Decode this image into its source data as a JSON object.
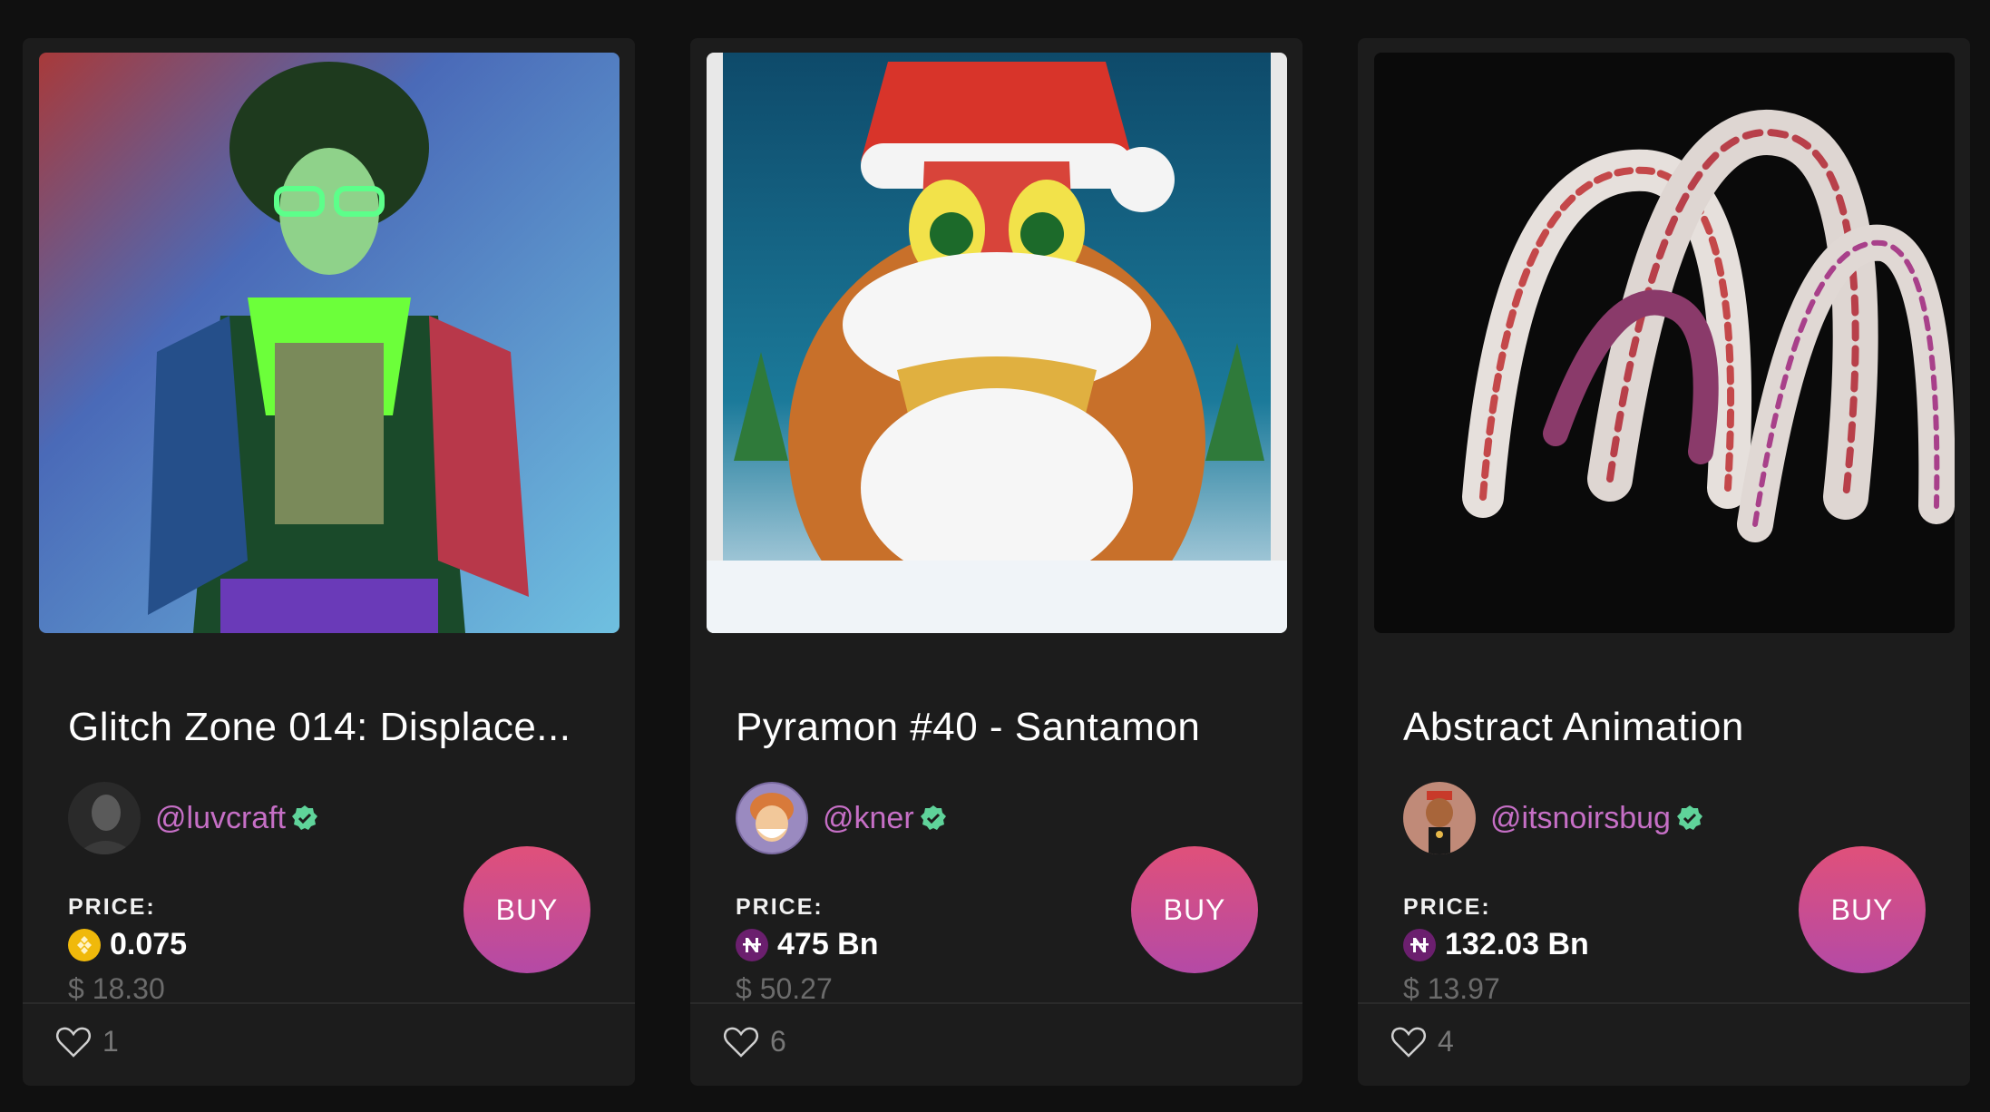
{
  "cards": [
    {
      "title": "Glitch Zone 014: Displace...",
      "creator": "@luvcraft",
      "price_label": "PRICE:",
      "price": "0.075",
      "currency_icon": "bnb-coin-icon",
      "currency_color": "#f0b90b",
      "usd": "$ 18.30",
      "buy_label": "BUY",
      "likes": "1"
    },
    {
      "title": "Pyramon #40 - Santamon",
      "creator": "@kner",
      "price_label": "PRICE:",
      "price": "475 Bn",
      "currency_icon": "n-coin-icon",
      "currency_color": "#6b1f6e",
      "usd": "$ 50.27",
      "buy_label": "BUY",
      "likes": "6"
    },
    {
      "title": "Abstract Animation",
      "creator": "@itsnoirsbug",
      "price_label": "PRICE:",
      "price": "132.03 Bn",
      "currency_icon": "n-coin-icon",
      "currency_color": "#6b1f6e",
      "usd": "$ 13.97",
      "buy_label": "BUY",
      "likes": "4"
    }
  ],
  "colors": {
    "background": "#101010",
    "card": "#1c1c1c",
    "handle": "#c66fc6",
    "verified": "#5fd39a",
    "buy_gradient_top": "#e0507a",
    "buy_gradient_bottom": "#b44aa6"
  }
}
